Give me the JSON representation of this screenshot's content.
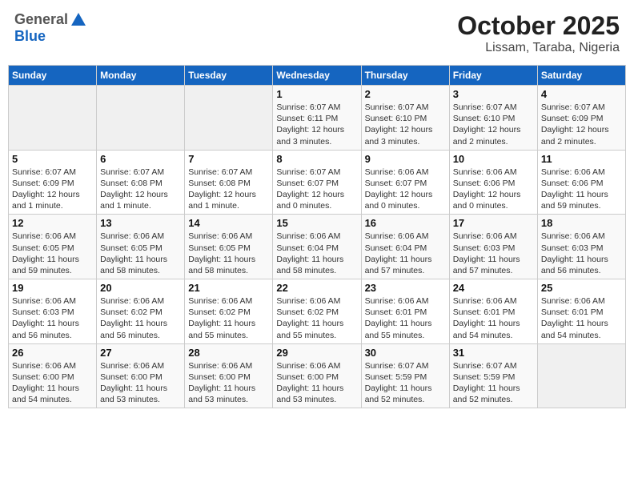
{
  "header": {
    "logo_general": "General",
    "logo_blue": "Blue",
    "title": "October 2025",
    "subtitle": "Lissam, Taraba, Nigeria"
  },
  "weekdays": [
    "Sunday",
    "Monday",
    "Tuesday",
    "Wednesday",
    "Thursday",
    "Friday",
    "Saturday"
  ],
  "weeks": [
    [
      {
        "day": "",
        "info": ""
      },
      {
        "day": "",
        "info": ""
      },
      {
        "day": "",
        "info": ""
      },
      {
        "day": "1",
        "info": "Sunrise: 6:07 AM\nSunset: 6:11 PM\nDaylight: 12 hours and 3 minutes."
      },
      {
        "day": "2",
        "info": "Sunrise: 6:07 AM\nSunset: 6:10 PM\nDaylight: 12 hours and 3 minutes."
      },
      {
        "day": "3",
        "info": "Sunrise: 6:07 AM\nSunset: 6:10 PM\nDaylight: 12 hours and 2 minutes."
      },
      {
        "day": "4",
        "info": "Sunrise: 6:07 AM\nSunset: 6:09 PM\nDaylight: 12 hours and 2 minutes."
      }
    ],
    [
      {
        "day": "5",
        "info": "Sunrise: 6:07 AM\nSunset: 6:09 PM\nDaylight: 12 hours and 1 minute."
      },
      {
        "day": "6",
        "info": "Sunrise: 6:07 AM\nSunset: 6:08 PM\nDaylight: 12 hours and 1 minute."
      },
      {
        "day": "7",
        "info": "Sunrise: 6:07 AM\nSunset: 6:08 PM\nDaylight: 12 hours and 1 minute."
      },
      {
        "day": "8",
        "info": "Sunrise: 6:07 AM\nSunset: 6:07 PM\nDaylight: 12 hours and 0 minutes."
      },
      {
        "day": "9",
        "info": "Sunrise: 6:06 AM\nSunset: 6:07 PM\nDaylight: 12 hours and 0 minutes."
      },
      {
        "day": "10",
        "info": "Sunrise: 6:06 AM\nSunset: 6:06 PM\nDaylight: 12 hours and 0 minutes."
      },
      {
        "day": "11",
        "info": "Sunrise: 6:06 AM\nSunset: 6:06 PM\nDaylight: 11 hours and 59 minutes."
      }
    ],
    [
      {
        "day": "12",
        "info": "Sunrise: 6:06 AM\nSunset: 6:05 PM\nDaylight: 11 hours and 59 minutes."
      },
      {
        "day": "13",
        "info": "Sunrise: 6:06 AM\nSunset: 6:05 PM\nDaylight: 11 hours and 58 minutes."
      },
      {
        "day": "14",
        "info": "Sunrise: 6:06 AM\nSunset: 6:05 PM\nDaylight: 11 hours and 58 minutes."
      },
      {
        "day": "15",
        "info": "Sunrise: 6:06 AM\nSunset: 6:04 PM\nDaylight: 11 hours and 58 minutes."
      },
      {
        "day": "16",
        "info": "Sunrise: 6:06 AM\nSunset: 6:04 PM\nDaylight: 11 hours and 57 minutes."
      },
      {
        "day": "17",
        "info": "Sunrise: 6:06 AM\nSunset: 6:03 PM\nDaylight: 11 hours and 57 minutes."
      },
      {
        "day": "18",
        "info": "Sunrise: 6:06 AM\nSunset: 6:03 PM\nDaylight: 11 hours and 56 minutes."
      }
    ],
    [
      {
        "day": "19",
        "info": "Sunrise: 6:06 AM\nSunset: 6:03 PM\nDaylight: 11 hours and 56 minutes."
      },
      {
        "day": "20",
        "info": "Sunrise: 6:06 AM\nSunset: 6:02 PM\nDaylight: 11 hours and 56 minutes."
      },
      {
        "day": "21",
        "info": "Sunrise: 6:06 AM\nSunset: 6:02 PM\nDaylight: 11 hours and 55 minutes."
      },
      {
        "day": "22",
        "info": "Sunrise: 6:06 AM\nSunset: 6:02 PM\nDaylight: 11 hours and 55 minutes."
      },
      {
        "day": "23",
        "info": "Sunrise: 6:06 AM\nSunset: 6:01 PM\nDaylight: 11 hours and 55 minutes."
      },
      {
        "day": "24",
        "info": "Sunrise: 6:06 AM\nSunset: 6:01 PM\nDaylight: 11 hours and 54 minutes."
      },
      {
        "day": "25",
        "info": "Sunrise: 6:06 AM\nSunset: 6:01 PM\nDaylight: 11 hours and 54 minutes."
      }
    ],
    [
      {
        "day": "26",
        "info": "Sunrise: 6:06 AM\nSunset: 6:00 PM\nDaylight: 11 hours and 54 minutes."
      },
      {
        "day": "27",
        "info": "Sunrise: 6:06 AM\nSunset: 6:00 PM\nDaylight: 11 hours and 53 minutes."
      },
      {
        "day": "28",
        "info": "Sunrise: 6:06 AM\nSunset: 6:00 PM\nDaylight: 11 hours and 53 minutes."
      },
      {
        "day": "29",
        "info": "Sunrise: 6:06 AM\nSunset: 6:00 PM\nDaylight: 11 hours and 53 minutes."
      },
      {
        "day": "30",
        "info": "Sunrise: 6:07 AM\nSunset: 5:59 PM\nDaylight: 11 hours and 52 minutes."
      },
      {
        "day": "31",
        "info": "Sunrise: 6:07 AM\nSunset: 5:59 PM\nDaylight: 11 hours and 52 minutes."
      },
      {
        "day": "",
        "info": ""
      }
    ]
  ]
}
